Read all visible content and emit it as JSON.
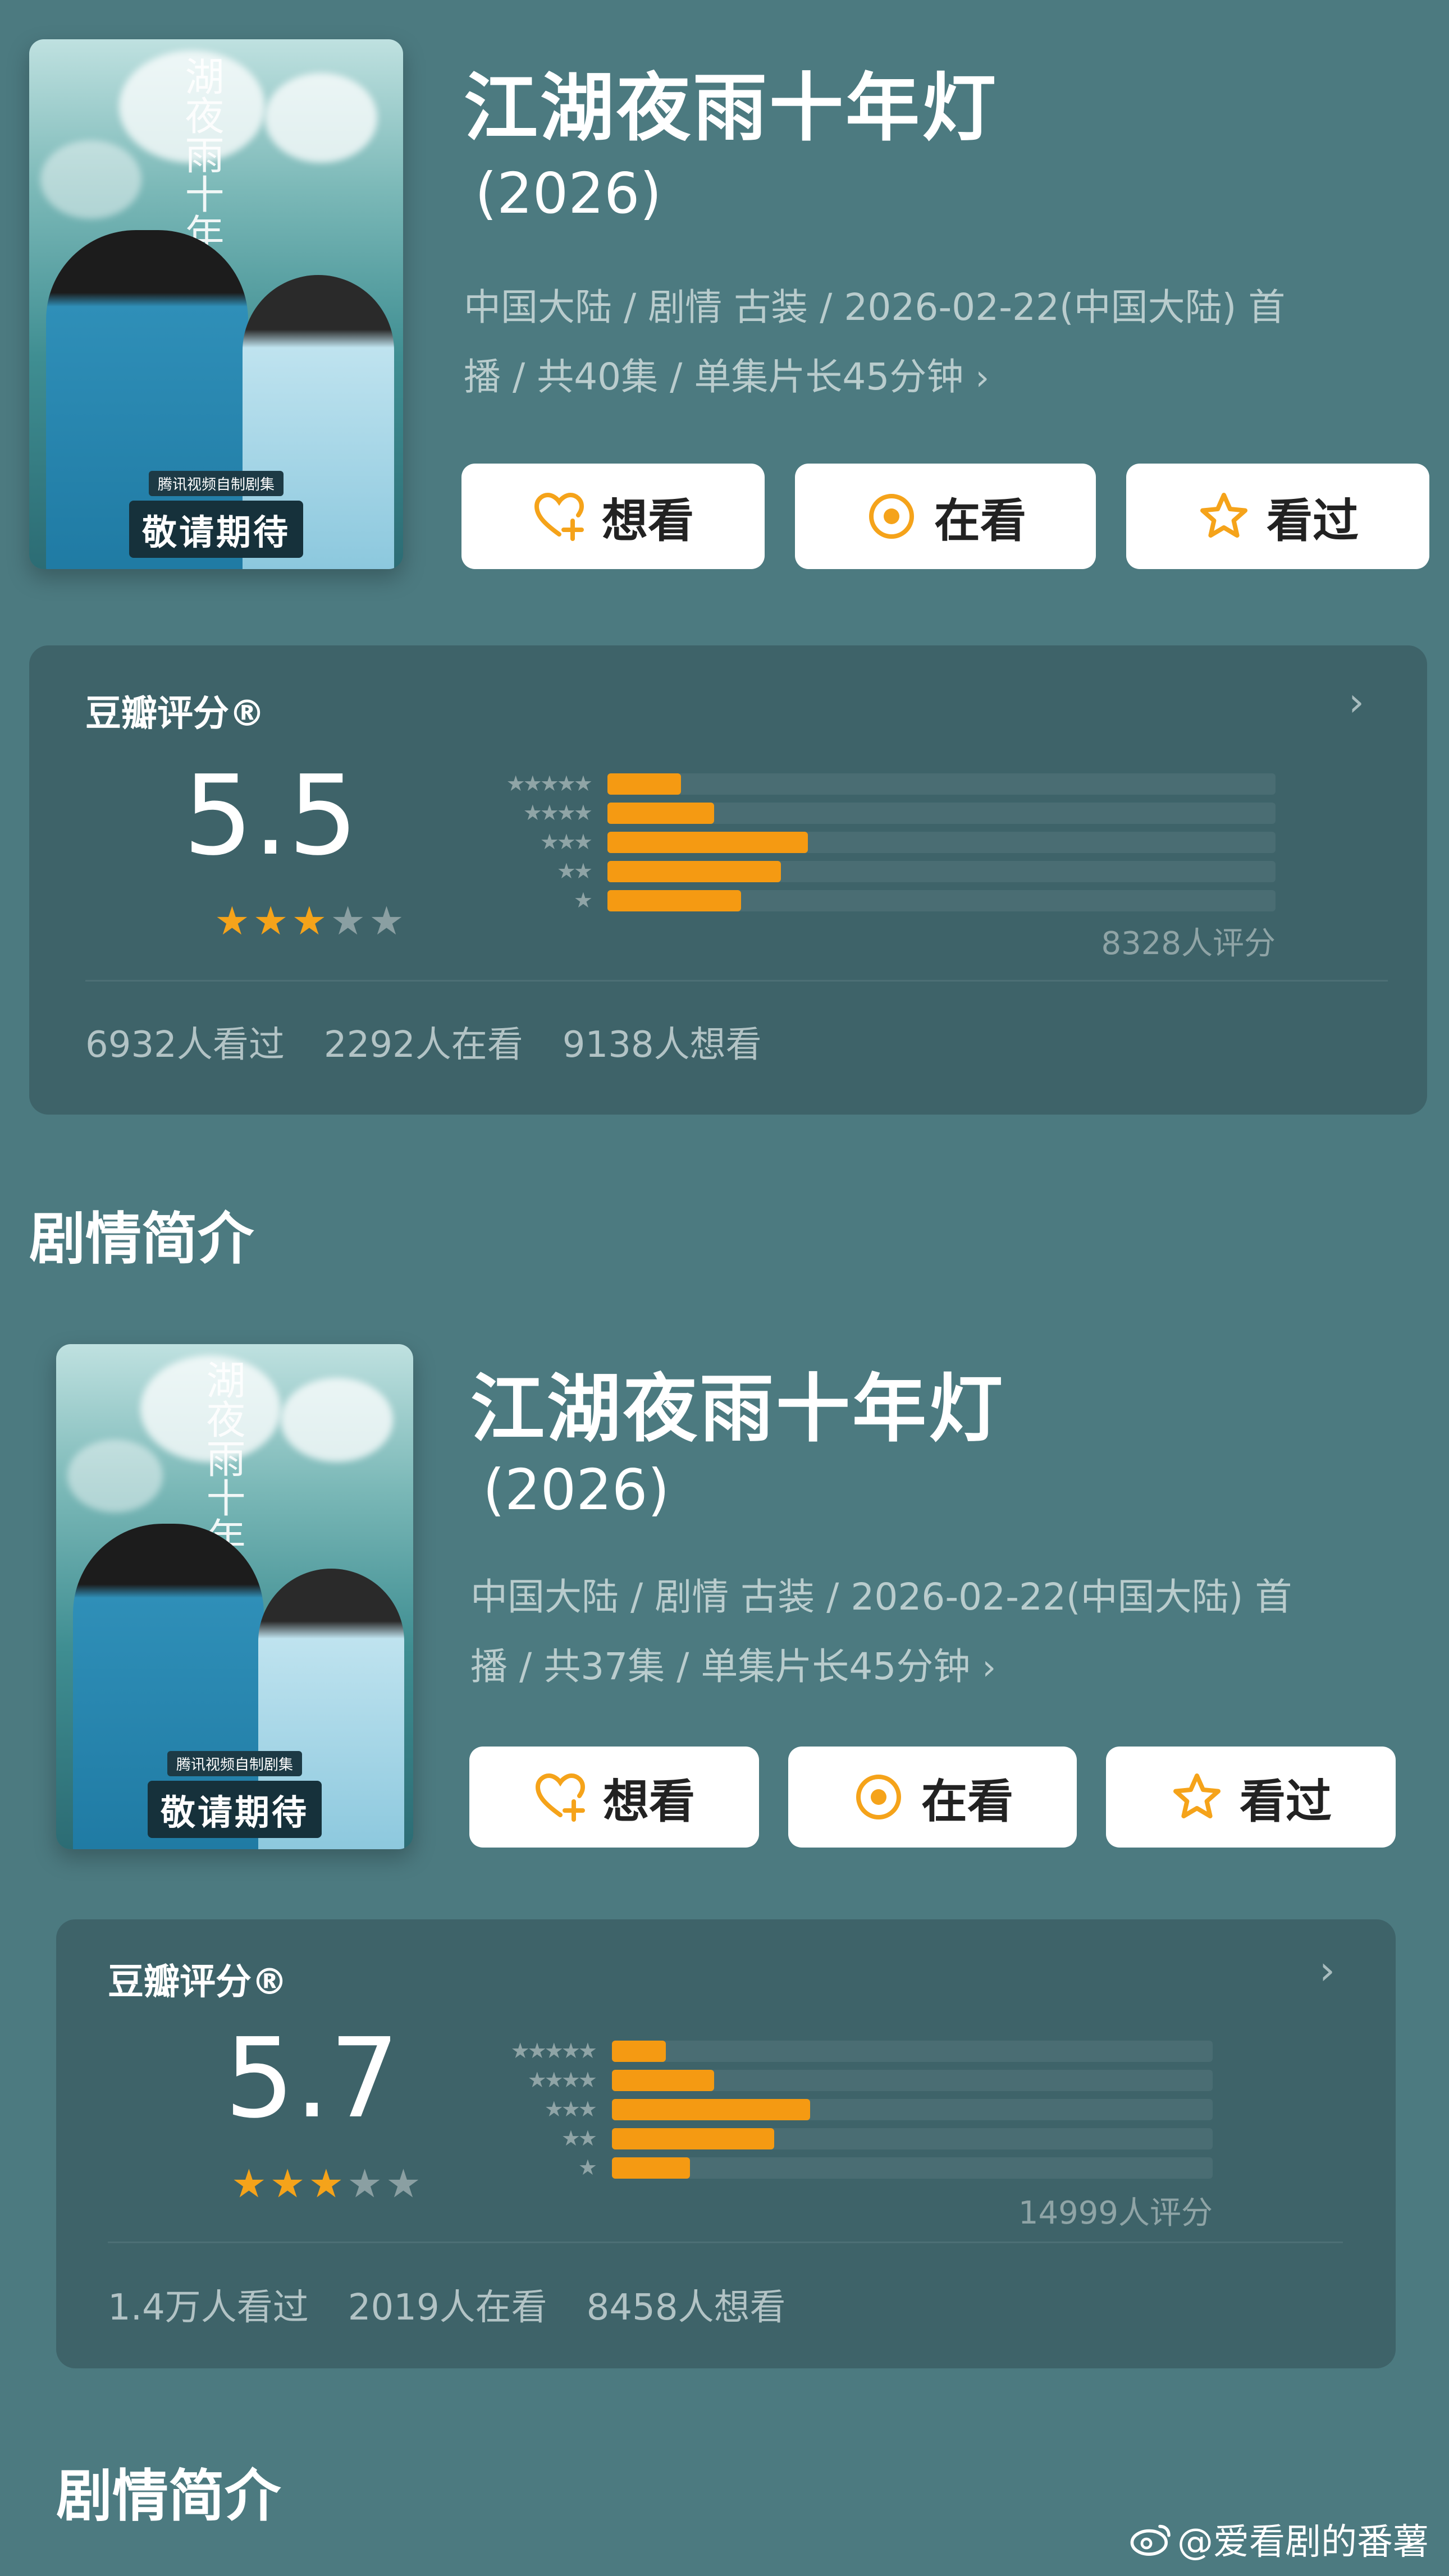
{
  "entries": [
    {
      "title": "江湖夜雨十年灯",
      "year": "(2026)",
      "meta_line1": "中国大陆 / 剧情 古装 / 2026-02-22(中国大陆) 首",
      "meta_line2": "播 / 共40集 / 单集片长45分钟",
      "poster_title": "湖夜雨十年灯",
      "poster_banner_small": "腾讯视频自制剧集",
      "poster_banner_big": "敬请期待",
      "buttons": {
        "want": "想看",
        "watching": "在看",
        "watched": "看过"
      },
      "rating": {
        "label": "豆瓣评分®",
        "score": "5.5",
        "stars_filled": 3,
        "stars_total": 5,
        "distribution": [
          11,
          16,
          30,
          26,
          20
        ],
        "count_text": "8328人评分",
        "stats": [
          "6932人看过",
          "2292人在看",
          "9138人想看"
        ]
      }
    },
    {
      "title": "江湖夜雨十年灯",
      "year": "(2026)",
      "meta_line1": "中国大陆 / 剧情 古装 / 2026-02-22(中国大陆) 首",
      "meta_line2": "播 / 共37集 / 单集片长45分钟",
      "poster_title": "湖夜雨十年灯",
      "poster_banner_small": "腾讯视频自制剧集",
      "poster_banner_big": "敬请期待",
      "buttons": {
        "want": "想看",
        "watching": "在看",
        "watched": "看过"
      },
      "rating": {
        "label": "豆瓣评分®",
        "score": "5.7",
        "stars_filled": 3,
        "stars_total": 5,
        "distribution": [
          9,
          17,
          33,
          27,
          13
        ],
        "count_text": "14999人评分",
        "stats": [
          "1.4万人看过",
          "2019人在看",
          "8458人想看"
        ]
      }
    }
  ],
  "section_heading": "剧情简介",
  "watermark": "@爱看剧的番薯",
  "colors": {
    "background": "#4c7a80",
    "card": "#3e6369",
    "accent": "#f59a12"
  },
  "icons": {
    "want": "heart-plus-icon",
    "watching": "target-circle-icon",
    "watched": "star-outline-icon",
    "more": "chevron-right-icon"
  }
}
